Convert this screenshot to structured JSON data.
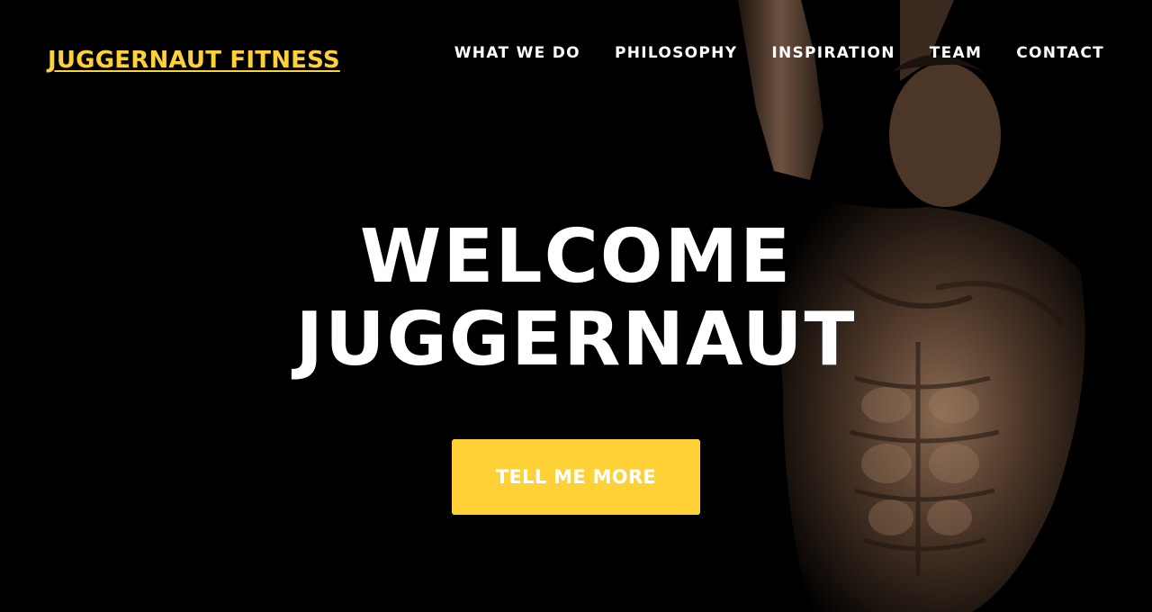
{
  "header": {
    "brand": "JUGGERNAUT FITNESS",
    "nav": [
      {
        "label": "WHAT WE DO"
      },
      {
        "label": "PHILOSOPHY"
      },
      {
        "label": "INSPIRATION"
      },
      {
        "label": "TEAM"
      },
      {
        "label": "CONTACT"
      }
    ]
  },
  "hero": {
    "heading_line1": "WELCOME",
    "heading_line2": "JUGGERNAUT",
    "cta_label": "TELL ME MORE",
    "background_image": "athlete-photo"
  },
  "colors": {
    "accent": "#fed136",
    "background": "#000000",
    "text": "#ffffff"
  }
}
